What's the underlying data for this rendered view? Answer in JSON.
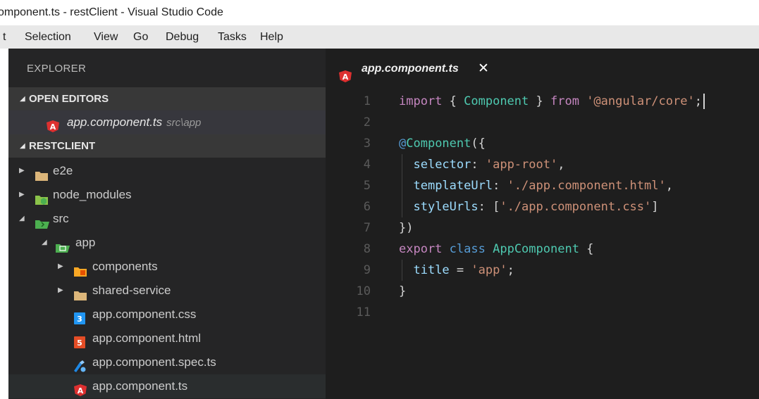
{
  "window": {
    "title": "omponent.ts - restClient - Visual Studio Code"
  },
  "menu": [
    "t",
    "Selection",
    "View",
    "Go",
    "Debug",
    "Tasks",
    "Help"
  ],
  "sidebar": {
    "title": "EXPLORER",
    "open_editors": {
      "header": "OPEN EDITORS",
      "items": [
        {
          "label": "app.component.ts",
          "path": "src\\app",
          "icon": "angular-icon"
        }
      ]
    },
    "project": {
      "header": "RESTCLIENT",
      "items": [
        {
          "label": "e2e",
          "icon": "folder-icon"
        },
        {
          "label": "node_modules",
          "icon": "node-folder-icon"
        },
        {
          "label": "src",
          "icon": "src-folder-icon"
        },
        {
          "label": "app",
          "icon": "app-folder-icon"
        },
        {
          "label": "components",
          "icon": "components-folder-icon"
        },
        {
          "label": "shared-service",
          "icon": "folder-icon"
        },
        {
          "label": "app.component.css",
          "icon": "css-icon"
        },
        {
          "label": "app.component.html",
          "icon": "html-icon"
        },
        {
          "label": "app.component.spec.ts",
          "icon": "spec-icon"
        },
        {
          "label": "app.component.ts",
          "icon": "angular-icon"
        }
      ]
    }
  },
  "editor": {
    "tab": {
      "label": "app.component.ts",
      "close": "✕"
    },
    "line_numbers": [
      "1",
      "2",
      "3",
      "4",
      "5",
      "6",
      "7",
      "8",
      "9",
      "10",
      "11"
    ],
    "code": [
      [
        [
          "kw",
          "import"
        ],
        [
          "punc",
          " { "
        ],
        [
          "cls",
          "Component"
        ],
        [
          "punc",
          " } "
        ],
        [
          "kw",
          "from"
        ],
        [
          "punc",
          " "
        ],
        [
          "str",
          "'@angular/core'"
        ],
        [
          "punc",
          ";"
        ]
      ],
      [],
      [
        [
          "kw2",
          "@"
        ],
        [
          "cls",
          "Component"
        ],
        [
          "punc",
          "({"
        ]
      ],
      [
        [
          "punc",
          "  "
        ],
        [
          "prop",
          "selector"
        ],
        [
          "punc",
          ": "
        ],
        [
          "str",
          "'app-root'"
        ],
        [
          "punc",
          ","
        ]
      ],
      [
        [
          "punc",
          "  "
        ],
        [
          "prop",
          "templateUrl"
        ],
        [
          "punc",
          ": "
        ],
        [
          "str",
          "'./app.component.html'"
        ],
        [
          "punc",
          ","
        ]
      ],
      [
        [
          "punc",
          "  "
        ],
        [
          "prop",
          "styleUrls"
        ],
        [
          "punc",
          ": ["
        ],
        [
          "str",
          "'./app.component.css'"
        ],
        [
          "punc",
          "]"
        ]
      ],
      [
        [
          "punc",
          "})"
        ]
      ],
      [
        [
          "kw",
          "export"
        ],
        [
          "punc",
          " "
        ],
        [
          "kw2",
          "class"
        ],
        [
          "punc",
          " "
        ],
        [
          "cls",
          "AppComponent"
        ],
        [
          "punc",
          " {"
        ]
      ],
      [
        [
          "punc",
          "  "
        ],
        [
          "prop",
          "title"
        ],
        [
          "punc",
          " = "
        ],
        [
          "str",
          "'app'"
        ],
        [
          "punc",
          ";"
        ]
      ],
      [
        [
          "punc",
          "}"
        ]
      ],
      []
    ]
  }
}
